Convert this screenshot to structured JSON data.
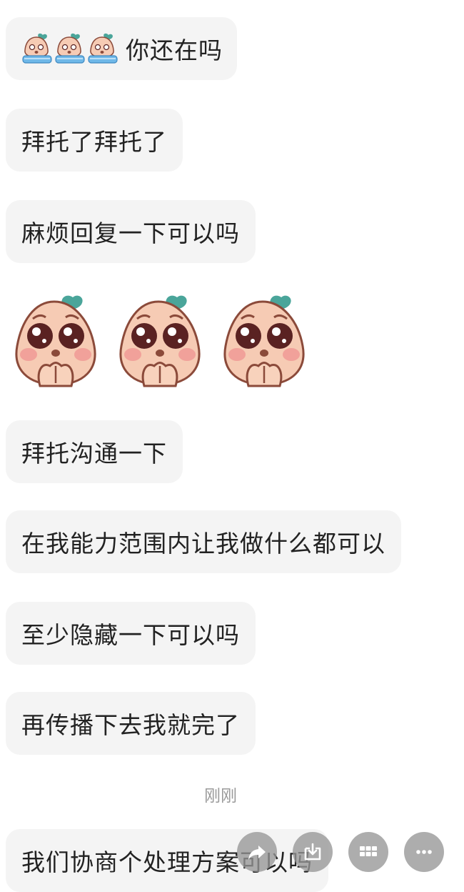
{
  "messages": [
    {
      "text": "你还在吗",
      "emoji_prefix": "crying-peach-emoji-x3"
    },
    {
      "text": "拜托了拜托了"
    },
    {
      "text": "麻烦回复一下可以吗"
    },
    {
      "sticker": "pleading-peach-sticker-x3"
    },
    {
      "text": "拜托沟通一下"
    },
    {
      "text": "在我能力范围内让我做什么都可以"
    },
    {
      "text": "至少隐藏一下可以吗"
    },
    {
      "text": "再传播下去我就完了"
    }
  ],
  "timestamp": "刚刚",
  "last_message": {
    "text": "我们协商个处理方案可以吗"
  },
  "floating_actions": [
    {
      "name": "share",
      "icon": "share-arrow-icon"
    },
    {
      "name": "save",
      "icon": "download-box-icon"
    },
    {
      "name": "grid",
      "icon": "grid-icon"
    },
    {
      "name": "more",
      "icon": "more-dots-icon"
    }
  ],
  "colors": {
    "bubble": "#f4f4f4",
    "text": "#222222",
    "timestamp": "#9a9a9a",
    "fab": "#969696",
    "peach_skin": "#f6cbb4",
    "peach_leaf": "#4aa59a"
  }
}
